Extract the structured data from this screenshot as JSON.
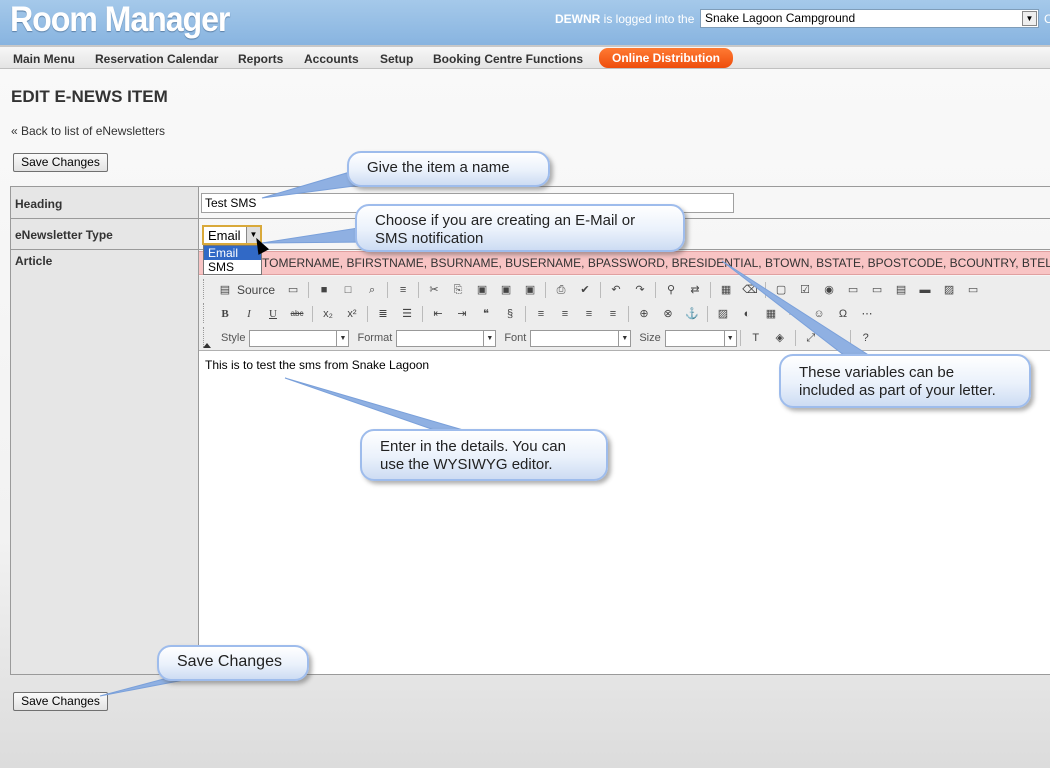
{
  "app": {
    "title": "Room Manager",
    "login": {
      "user": "DEWNR",
      "text": "is logged into the",
      "property": "Snake Lagoon Campground",
      "cut": "C"
    }
  },
  "nav": {
    "items": [
      "Main Menu",
      "Reservation Calendar",
      "Reports",
      "Accounts",
      "Setup",
      "Booking Centre Functions"
    ],
    "online": "Online Distribution",
    "online_color": "#f05a14"
  },
  "page": {
    "title": "EDIT E-NEWS ITEM",
    "back_link": "« Back to list of eNewsletters",
    "save_label": "Save Changes"
  },
  "form": {
    "heading_label": "Heading",
    "heading_value": "Test SMS",
    "type_label": "eNewsletter Type",
    "type_value": "Email",
    "type_options": [
      "Email",
      "SMS"
    ],
    "article_label": "Article",
    "variables": "TOMERNAME, BFIRSTNAME, BSURNAME, BUSERNAME, BPASSWORD, BRESIDENTIAL, BTOWN, BSTATE, BPOSTCODE, BCOUNTRY, BTELNO",
    "article_text": "This is to test the sms from Snake Lagoon"
  },
  "editor": {
    "source_label": "Source",
    "style_label": "Style",
    "format_label": "Format",
    "font_label": "Font",
    "size_label": "Size"
  },
  "callouts": {
    "name": "Give the item a name",
    "type": "Choose if you are creating an E-Mail or SMS notification",
    "variables": "These variables can be included as part of your letter.",
    "details": "Enter in the details. You can use the WYSIWYG editor.",
    "save": "Save Changes"
  }
}
